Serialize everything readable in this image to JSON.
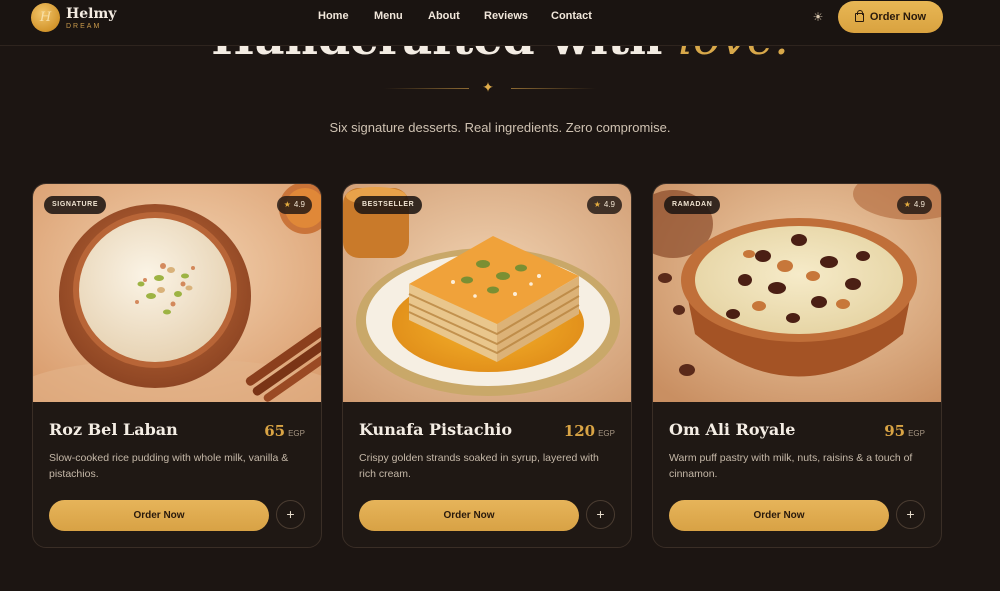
{
  "brand": {
    "mark": "H",
    "name": "Helmy",
    "tagline": "DREAM"
  },
  "nav": {
    "links": [
      "Home",
      "Menu",
      "About",
      "Reviews",
      "Contact"
    ],
    "order_label": "Order Now"
  },
  "hero": {
    "title_main": "Handcrafted with",
    "title_accent": "love.",
    "subtitle": "Six signature desserts. Real ingredients. Zero compromise."
  },
  "colors": {
    "accent": "#d9a445",
    "background": "#1c1512",
    "card": "#1f1814"
  },
  "cards": [
    {
      "badge": "SIGNATURE",
      "rating": "4.9",
      "name": "Roz Bel Laban",
      "price": "65",
      "currency": "EGP",
      "description": "Slow-cooked rice pudding with whole milk, vanilla & pistachios.",
      "order_label": "Order Now",
      "plus": "+"
    },
    {
      "badge": "BESTSELLER",
      "rating": "4.9",
      "name": "Kunafa Pistachio",
      "price": "120",
      "currency": "EGP",
      "description": "Crispy golden strands soaked in syrup, layered with rich cream.",
      "order_label": "Order Now",
      "plus": "+"
    },
    {
      "badge": "RAMADAN",
      "rating": "4.9",
      "name": "Om Ali Royale",
      "price": "95",
      "currency": "EGP",
      "description": "Warm puff pastry with milk, nuts, raisins & a touch of cinnamon.",
      "order_label": "Order Now",
      "plus": "+"
    }
  ]
}
